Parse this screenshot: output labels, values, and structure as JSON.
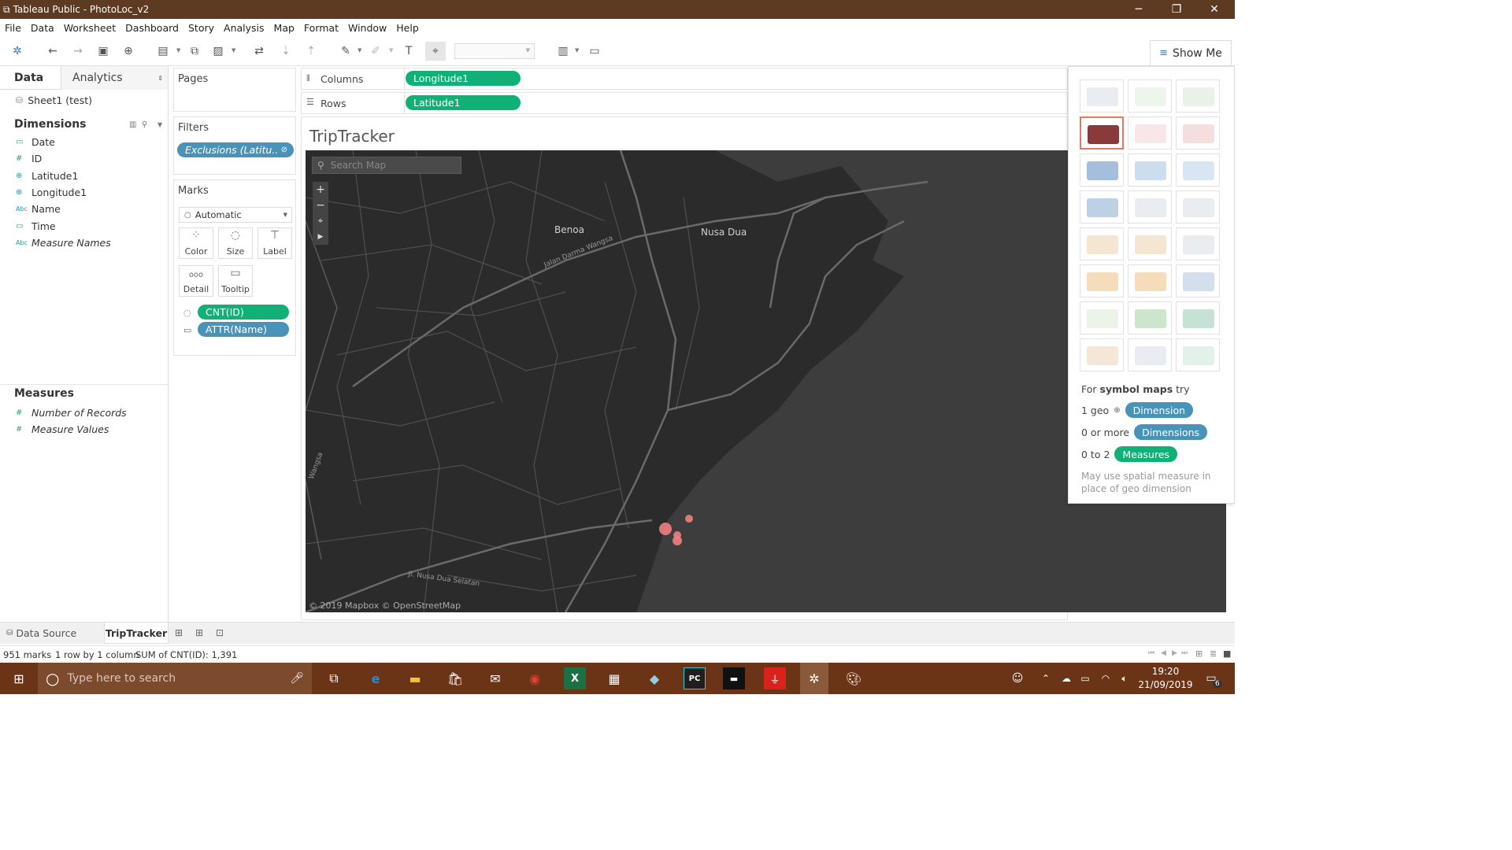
{
  "window": {
    "title": "Tableau Public - PhotoLoc_v2",
    "minimize": "─",
    "maximize": "❐",
    "close": "✕"
  },
  "menu": [
    "File",
    "Data",
    "Worksheet",
    "Dashboard",
    "Story",
    "Analysis",
    "Map",
    "Format",
    "Window",
    "Help"
  ],
  "toolbar": {
    "show_me": "Show Me"
  },
  "data_pane": {
    "tab_data": "Data",
    "tab_analytics": "Analytics",
    "datasource": "Sheet1 (test)",
    "dimensions_header": "Dimensions",
    "dimensions": [
      {
        "icon": "date-icon",
        "glyph": "▭",
        "name": "Date",
        "italic": false
      },
      {
        "icon": "number-icon",
        "glyph": "#",
        "name": "ID",
        "italic": false
      },
      {
        "icon": "globe-icon",
        "glyph": "⊕",
        "name": "Latitude1",
        "italic": false
      },
      {
        "icon": "globe-icon",
        "glyph": "⊕",
        "name": "Longitude1",
        "italic": false
      },
      {
        "icon": "string-icon",
        "glyph": "Abc",
        "name": "Name",
        "italic": false
      },
      {
        "icon": "date-icon",
        "glyph": "▭",
        "name": "Time",
        "italic": false
      },
      {
        "icon": "string-icon",
        "glyph": "Abc",
        "name": "Measure Names",
        "italic": true
      }
    ],
    "measures_header": "Measures",
    "measures": [
      {
        "icon": "number-icon",
        "glyph": "#",
        "name": "Number of Records"
      },
      {
        "icon": "number-icon",
        "glyph": "#",
        "name": "Measure Values"
      }
    ]
  },
  "cards": {
    "pages": "Pages",
    "filters": "Filters",
    "filter_pill": "Exclusions (Latitu..",
    "marks": "Marks",
    "mark_type": "Automatic",
    "mark_buttons": [
      "Color",
      "Size",
      "Label",
      "Detail",
      "Tooltip"
    ],
    "mark_pills": [
      "CNT(ID)",
      "ATTR(Name)"
    ]
  },
  "shelves": {
    "columns_label": "Columns",
    "columns_pill": "Longitude1",
    "rows_label": "Rows",
    "rows_pill": "Latitude1"
  },
  "viz": {
    "title": "TripTracker",
    "search_placeholder": "Search Map",
    "zoom_in": "+",
    "zoom_out": "−",
    "labels": {
      "benoa": "Benoa",
      "nusa_dua": "Nusa Dua",
      "road1": "Jalan Darma Wangsa",
      "road2": "Jl. Nusa Dua Selatan",
      "road3": "Wangsa"
    },
    "attribution": "© 2019 Mapbox © OpenStreetMap",
    "mark_color": "#f08080"
  },
  "show_me": {
    "hint_prefix": "For ",
    "hint_bold": "symbol maps",
    "hint_suffix": " try",
    "rows": [
      {
        "label": "1 geo",
        "pill": "Dimension",
        "color": "#4a93b8"
      },
      {
        "label": "0 or more",
        "pill": "Dimensions",
        "color": "#4a93b8"
      },
      {
        "label": "0 to 2",
        "pill": "Measures",
        "color": "#10b077"
      }
    ],
    "note": "May use spatial measure in place of geo dimension"
  },
  "sheet_tabs": {
    "data_source": "Data Source",
    "sheet": "TripTracker"
  },
  "status": {
    "marks": "951 marks",
    "dims": "1 row by 1 column",
    "sum": "SUM of CNT(ID): 1,391"
  },
  "taskbar": {
    "search": "Type here to search",
    "time": "19:20",
    "date": "21/09/2019",
    "notif_count": "6"
  }
}
